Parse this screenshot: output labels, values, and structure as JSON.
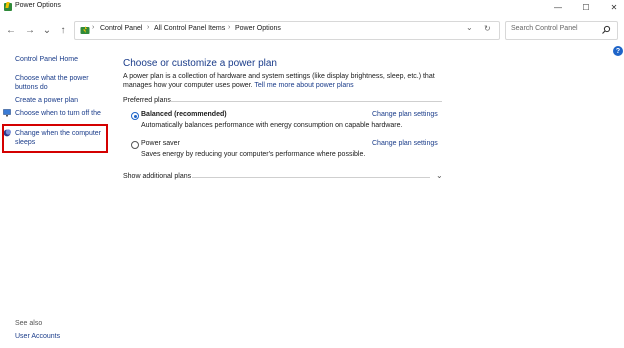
{
  "window": {
    "title": "Power Options",
    "minimize": "—",
    "maximize": "☐",
    "close": "✕"
  },
  "nav": {
    "back": "←",
    "forward": "→",
    "recent": "⌄",
    "up": "↑",
    "breadcrumb": [
      "Control Panel",
      "All Control Panel Items",
      "Power Options"
    ],
    "sep": "›",
    "dropdown": "⌄",
    "refresh": "↻",
    "search_placeholder": "Search Control Panel"
  },
  "sidebar": {
    "home": "Control Panel Home",
    "items": [
      {
        "label": "Choose what the power buttons do"
      },
      {
        "label": "Create a power plan"
      },
      {
        "label": "Choose when to turn off the display"
      },
      {
        "label": "Change when the computer sleeps"
      }
    ],
    "see_also": "See also",
    "user_accounts": "User Accounts"
  },
  "main": {
    "title": "Choose or customize a power plan",
    "desc_1": "A power plan is a collection of hardware and system settings (like display brightness, sleep, etc.) that manages",
    "desc_2": "how your computer uses power.",
    "desc_link": "Tell me more about power plans",
    "preferred_label": "Preferred plans",
    "plans": [
      {
        "name": "Balanced (recommended)",
        "desc": "Automatically balances performance with energy consumption on capable hardware.",
        "link": "Change plan settings",
        "selected": true
      },
      {
        "name": "Power saver",
        "desc": "Saves energy by reducing your computer's performance where possible.",
        "link": "Change plan settings",
        "selected": false
      }
    ],
    "show_additional": "Show additional plans",
    "help": "?"
  },
  "colors": {
    "link": "#1a3c8a",
    "accent": "#1e64c8",
    "highlight": "#d40000"
  }
}
